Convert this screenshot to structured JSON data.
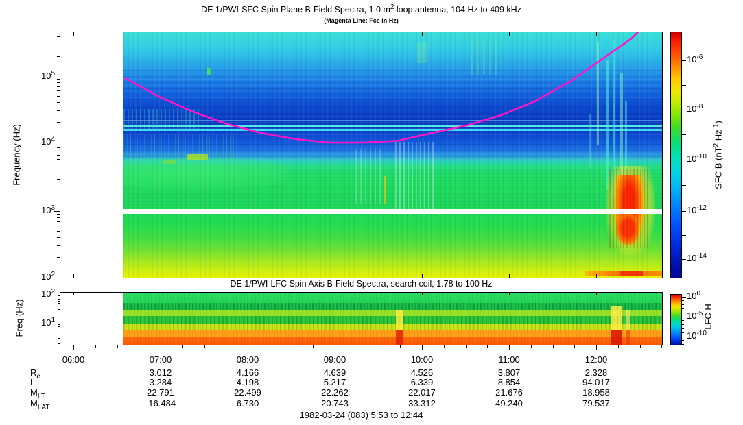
{
  "figure": {
    "bg": "#FFFFFF",
    "footer": "1982-03-24 (083) 5:53 to 12:44"
  },
  "sfc": {
    "title_pre": "DE 1/PWI-SFC  Spin Plane B-Field Spectra, 1.0 m",
    "title_sup": "2",
    "title_post": " loop antenna, 104 Hz to 409 kHz",
    "subtitle": "(Magenta Line: Fce in Hz)",
    "ylabel": "Frequency (Hz)",
    "ytick_exps": [
      "5",
      "4",
      "3",
      "2"
    ],
    "fce_color": "#FF14C8",
    "colorbar": {
      "label_pre": "SFC B (nT",
      "label_sup1": "2",
      "label_mid": " Hz",
      "label_sup2": "-1",
      "label_post": ")",
      "tick_exps": [
        "-6",
        "-8",
        "-10",
        "-12",
        "-14"
      ]
    }
  },
  "lfc": {
    "title": "DE 1/PWI-LFC  Spin Axis B-Field Spectra, search coil, 1.78 to 100 Hz",
    "ylabel": "Freq (Hz)",
    "ytick_exps": [
      "2",
      "1"
    ],
    "colorbar": {
      "label": "LFC H",
      "tick_exps": [
        "0",
        "-5",
        "-10"
      ]
    }
  },
  "xaxis": {
    "labels": [
      "06:00",
      "07:00",
      "08:00",
      "09:00",
      "10:00",
      "11:00",
      "12:00"
    ]
  },
  "ephemeris": {
    "rows": [
      {
        "base": "R",
        "sub": "e",
        "values": [
          "3.012",
          "4.166",
          "4.639",
          "4.526",
          "3.807",
          "2.328"
        ]
      },
      {
        "base": "L",
        "sub": "",
        "values": [
          "3.284",
          "4.198",
          "5.217",
          "6.339",
          "8.854",
          "94.017"
        ]
      },
      {
        "base": "M",
        "sub": "LT",
        "values": [
          "22.791",
          "22.499",
          "22.262",
          "22.017",
          "21.676",
          "18.958"
        ]
      },
      {
        "base": "M",
        "sub": "LAT",
        "values": [
          "-16.484",
          "6.730",
          "20.743",
          "33.312",
          "49.240",
          "79.537"
        ]
      }
    ]
  },
  "chart_data": [
    {
      "type": "heatmap",
      "instrument": "DE 1/PWI-SFC",
      "title": "DE 1/PWI-SFC  Spin Plane B-Field Spectra, 1.0 m2 loop antenna, 104 Hz to 409 kHz",
      "subtitle": "(Magenta Line: Fce in Hz)",
      "ylabel": "Frequency (Hz)",
      "y_scale": "log",
      "y_range_hz": [
        100,
        460000
      ],
      "y_ticks_hz": [
        100,
        1000,
        10000,
        100000
      ],
      "x_range": [
        "05:53",
        "12:48"
      ],
      "x_ticks": [
        "06:00",
        "07:00",
        "08:00",
        "09:00",
        "10:00",
        "11:00",
        "12:00"
      ],
      "data_coverage": [
        "06:38",
        "12:44"
      ],
      "colorbar": {
        "label": "SFC B (nT2 Hz-1)",
        "scale": "log",
        "ticks_label": [
          "1e-6",
          "1e-8",
          "1e-10",
          "1e-12",
          "1e-14"
        ],
        "colormap": "rainbow-jet"
      },
      "fce_line": {
        "color": "#FF14C8",
        "samples": [
          [
            "06:36",
            102000
          ],
          [
            "06:58",
            55000
          ],
          [
            "07:22",
            32000
          ],
          [
            "07:45",
            21000
          ],
          [
            "08:09",
            15200
          ],
          [
            "08:33",
            12300
          ],
          [
            "08:56",
            10900
          ],
          [
            "09:20",
            10900
          ],
          [
            "09:43",
            11600
          ],
          [
            "10:07",
            15200
          ],
          [
            "10:31",
            19800
          ],
          [
            "10:54",
            28000
          ],
          [
            "11:18",
            46000
          ],
          [
            "11:42",
            91000
          ],
          [
            "12:05",
            205000
          ],
          [
            "12:24",
            400000
          ],
          [
            "12:30",
            540000
          ]
        ]
      },
      "features": [
        "cyan broadband above ~100 kHz",
        "dark blue minimum between ~20 and 60 kHz",
        "two narrow cyan emission lines near 14-16 kHz",
        "green hiss band from ~200 Hz to 8 kHz, brighter patches 06:40-08:30",
        "horizontal white data gap near 1 kHz",
        "yellow intensification below ~300 Hz",
        "intense red-orange burst 12:10-12:25 spanning ~300 Hz to 6 kHz",
        "orange-red band near 100-130 Hz after 12:00"
      ]
    },
    {
      "type": "heatmap",
      "instrument": "DE 1/PWI-LFC",
      "title": "DE 1/PWI-LFC  Spin Axis B-Field Spectra, search coil, 1.78 to 100 Hz",
      "ylabel": "Freq (Hz)",
      "y_scale": "log",
      "y_range_hz": [
        1.78,
        100
      ],
      "y_ticks_hz": [
        10,
        100
      ],
      "x_range": [
        "05:53",
        "12:48"
      ],
      "x_ticks": [
        "06:00",
        "07:00",
        "08:00",
        "09:00",
        "10:00",
        "11:00",
        "12:00"
      ],
      "data_coverage": [
        "06:38",
        "12:44"
      ],
      "colorbar": {
        "label": "LFC H",
        "scale": "log",
        "ticks_label": [
          "1e0",
          "1e-5",
          "1e-10"
        ],
        "colormap": "rainbow-jet"
      },
      "features": [
        "green levels 10-100 Hz",
        "banded yellow-green structure 4-10 Hz",
        "orange to red-orange below ~4 Hz",
        "enhanced bursts (yellow/red columns) near 09:45 and 12:10"
      ]
    },
    {
      "type": "table",
      "name": "ephemeris",
      "columns": [
        "07:00",
        "08:00",
        "09:00",
        "10:00",
        "11:00",
        "12:00"
      ],
      "rows": {
        "Re": [
          3.012,
          4.166,
          4.639,
          4.526,
          3.807,
          2.328
        ],
        "L": [
          3.284,
          4.198,
          5.217,
          6.339,
          8.854,
          94.017
        ],
        "MLT": [
          22.791,
          22.499,
          22.262,
          22.017,
          21.676,
          18.958
        ],
        "MLAT": [
          -16.484,
          6.73,
          20.743,
          33.312,
          49.24,
          79.537
        ]
      },
      "caption": "1982-03-24 (083) 5:53 to 12:44"
    }
  ]
}
